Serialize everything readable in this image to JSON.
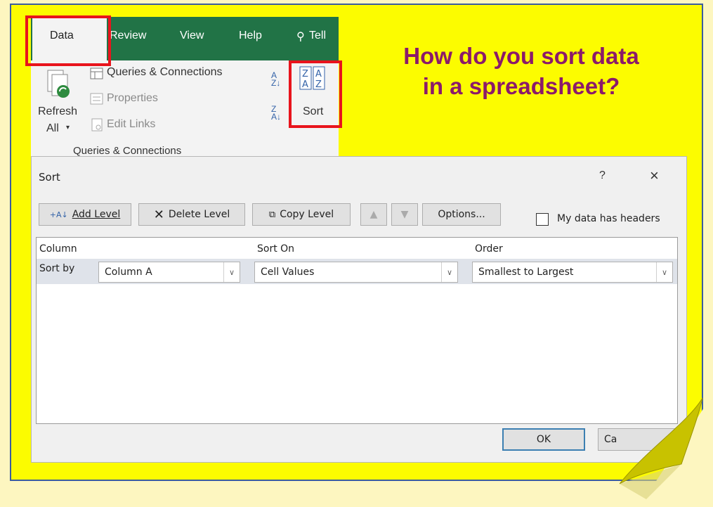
{
  "ribbon": {
    "tabs": {
      "data": "Data",
      "review": "Review",
      "view": "View",
      "help": "Help",
      "tell": "Tell"
    },
    "queries_connections": "Queries & Connections",
    "properties": "Properties",
    "refresh": "Refresh",
    "refresh_all": "All",
    "edit_links": "Edit Links",
    "group_label": "Queries & Connections",
    "sort": "Sort"
  },
  "heading": {
    "line1": "How do you sort data",
    "line2": "in a spreadsheet?"
  },
  "dialog": {
    "title": "Sort",
    "help": "?",
    "close": "×",
    "toolbar": {
      "add_level": "Add Level",
      "delete_level": "Delete Level",
      "copy_level": "Copy Level",
      "options": "Options..."
    },
    "headers_checkbox": {
      "label": "My data has headers",
      "checked": false
    },
    "columns": {
      "column": "Column",
      "sort_on": "Sort On",
      "order": "Order"
    },
    "row": {
      "label": "Sort by",
      "column": "Column A",
      "sort_on": "Cell Values",
      "order": "Smallest to Largest"
    },
    "ok": "OK",
    "cancel": "Ca"
  },
  "colors": {
    "excel_green": "#217346",
    "highlight_red": "#e8141c",
    "background_yellow": "#fcfc00",
    "heading": "#8b1a6a"
  }
}
